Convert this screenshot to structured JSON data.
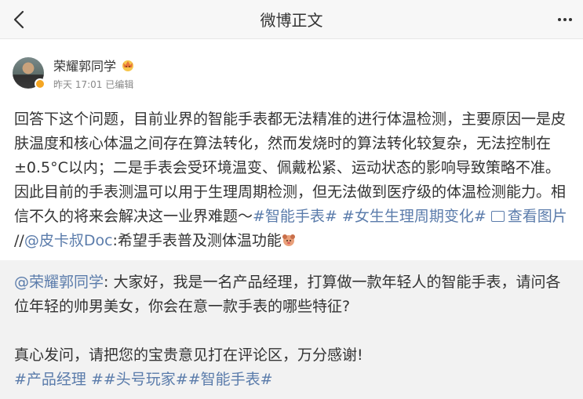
{
  "navbar": {
    "title": "微博正文"
  },
  "author": {
    "name": "荣耀郭同学",
    "time": "昨天 17:01",
    "edited": "已编辑"
  },
  "post": {
    "text": "回答下这个问题，目前业界的智能手表都无法精准的进行体温检测，主要原因一是皮肤温度和核心体温之间存在算法转化，然而发烧时的算法转化较复杂，无法控制在±0.5°C以内；二是手表会受环境温变、佩戴松紧、运动状态的影响导致策略不准。 因此目前的手表测温可以用于生理周期检测，但无法做到医疗级的体温检测能力。相信不久的将来会解决这一业界难题～",
    "topic1": "#智能手表#",
    "topic2": "#女生生理周期变化#",
    "view_pic": "查看图片",
    "repost_sep": "//",
    "mention": "@皮卡叔Doc",
    "mention_text": ":希望手表普及测体温功能"
  },
  "repost": {
    "mention": "@荣耀郭同学",
    "text1": ": 大家好，我是一名产品经理，打算做一款年轻人的智能手表，请问各位年轻的帅男美女，你会在意一款手表的哪些特征?",
    "text2": "真心发问，请把您的宝贵意见打在评论区，万分感谢!",
    "tags": "#产品经理 ##头号玩家##智能手表#"
  },
  "colors": {
    "link": "#5b7cab",
    "repost_bg": "#f2f2f2",
    "navbar_bg": "#f7f7f7"
  },
  "icons": {
    "back": "chevron-left-icon",
    "more": "more-dots-icon",
    "vip": "vip-crown-icon",
    "picture": "image-icon",
    "emoji": "dog-emoji-icon"
  }
}
